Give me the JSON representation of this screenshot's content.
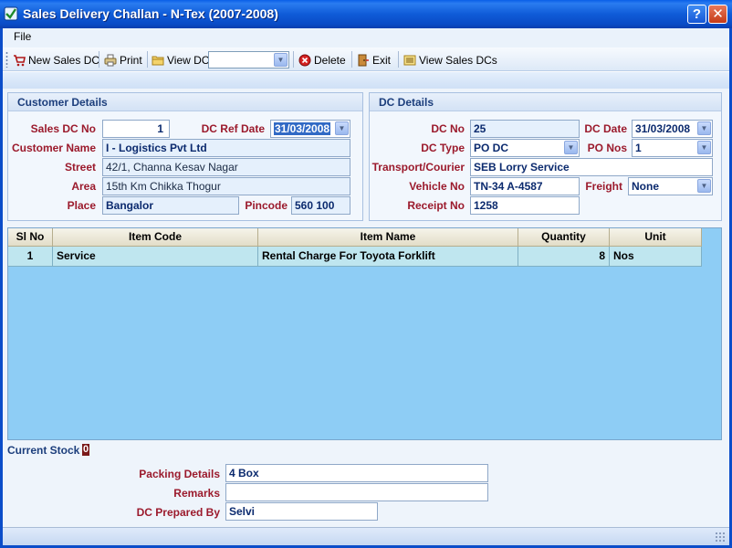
{
  "window": {
    "title": "Sales Delivery Challan - N-Tex (2007-2008)",
    "help": "?",
    "close": "✕"
  },
  "menu": {
    "file": "File"
  },
  "toolbar": {
    "new_sales_dc": "New Sales DC",
    "print": "Print",
    "view_dc": "View DC",
    "view_dc_value": "",
    "delete": "Delete",
    "exit": "Exit",
    "view_sales_dcs": "View Sales DCs"
  },
  "customer": {
    "title": "Customer Details",
    "sales_dc_no_label": "Sales DC No",
    "sales_dc_no": "1",
    "dc_ref_date_label": "DC Ref Date",
    "dc_ref_date": "31/03/2008",
    "customer_name_label": "Customer Name",
    "customer_name": "I - Logistics Pvt Ltd",
    "street_label": "Street",
    "street": "42/1, Channa Kesav Nagar",
    "area_label": "Area",
    "area": "15th Km Chikka Thogur",
    "place_label": "Place",
    "place": "Bangalor",
    "pincode_label": "Pincode",
    "pincode": "560 100"
  },
  "dc": {
    "title": "DC Details",
    "dc_no_label": "DC No",
    "dc_no": "25",
    "dc_date_label": "DC Date",
    "dc_date": "31/03/2008",
    "dc_type_label": "DC Type",
    "dc_type": "PO DC",
    "po_nos_label": "PO Nos",
    "po_nos": "1",
    "transport_label": "Transport/Courier",
    "transport": "SEB Lorry Service",
    "vehicle_no_label": "Vehicle No",
    "vehicle_no": "TN-34 A-4587",
    "freight_label": "Freight",
    "freight": "None",
    "receipt_no_label": "Receipt No",
    "receipt_no": "1258"
  },
  "grid": {
    "columns": [
      "Sl No",
      "Item Code",
      "Item Name",
      "Quantity",
      "Unit"
    ],
    "rows": [
      [
        "1",
        "Service",
        "Rental Charge For Toyota Forklift",
        "8",
        "Nos"
      ]
    ]
  },
  "stock": {
    "label": "Current Stock",
    "value": "0"
  },
  "bottom": {
    "packing_label": "Packing Details",
    "packing": "4 Box",
    "remarks_label": "Remarks",
    "remarks": "",
    "prepared_by_label": "DC Prepared By",
    "prepared_by": "Selvi"
  },
  "icons": {
    "app": "checkmark-app-icon",
    "new": "cart-icon",
    "print": "printer-icon",
    "view": "folder-icon",
    "delete": "delete-icon",
    "exit": "exit-door-icon",
    "view_all": "list-icon"
  }
}
